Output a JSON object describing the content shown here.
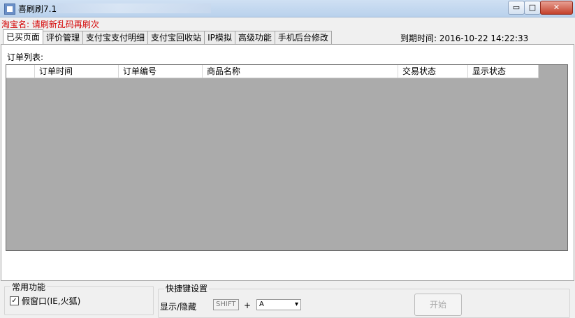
{
  "window": {
    "title": "喜刷刷7.1",
    "min_glyph": "▭",
    "max_glyph": "□",
    "close_glyph": "✕"
  },
  "taobao_name": "淘宝名: 请刷新乱码再刷次",
  "tabs": [
    {
      "label": "已买页面"
    },
    {
      "label": "评价管理"
    },
    {
      "label": "支付宝支付明细"
    },
    {
      "label": "支付宝回收站"
    },
    {
      "label": "IP模拟"
    },
    {
      "label": "高级功能"
    },
    {
      "label": "手机后台修改"
    }
  ],
  "expiry": "到期时间: 2016-10-22 14:22:33",
  "orders": {
    "label": "订单列表:",
    "columns": [
      "订单时间",
      "订单编号",
      "商品名称",
      "交易状态",
      "显示状态"
    ]
  },
  "common": {
    "title": "常用功能",
    "fake_window_checked": true,
    "fake_window_label": "假窗口(IE,火狐)"
  },
  "hotkey": {
    "title": "快捷键设置",
    "show_hide_label": "显示/隐藏",
    "modifier": "SHIFT",
    "plus": "+",
    "key_value": "A",
    "start_label": "开始"
  }
}
